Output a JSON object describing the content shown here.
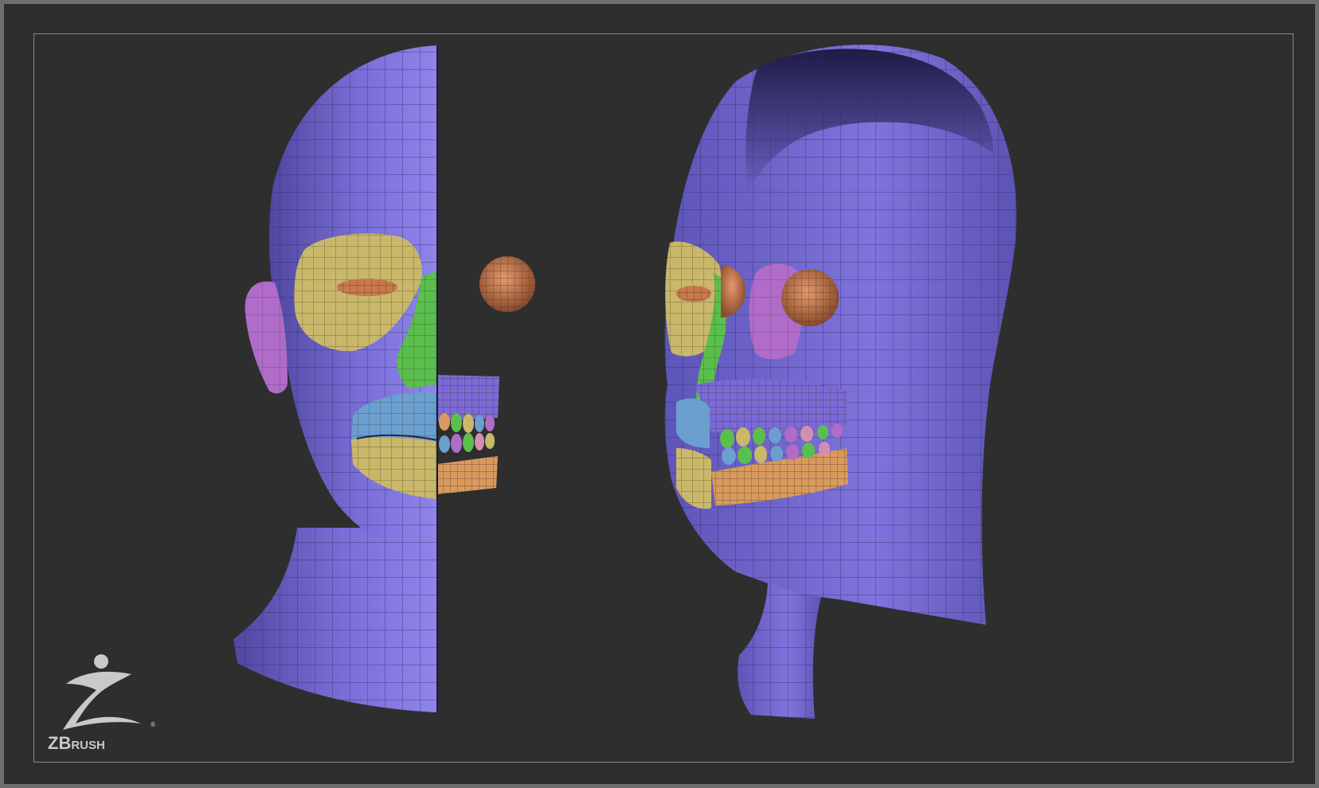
{
  "brand": {
    "logo_text": "ZBrush",
    "registered_mark": "®",
    "logo_icon": "zbrush-z-figure-icon"
  },
  "viewport": {
    "models": [
      {
        "name": "head-front-half",
        "view": "front"
      },
      {
        "name": "head-three-quarter-split",
        "view": "three-quarter"
      }
    ],
    "polygroup_colors": {
      "skin": "#6d62c9",
      "skin_light": "#8679e0",
      "eye_socket": "#c9b86a",
      "cheek": "#5bbf4d",
      "lip": "#6a9fd0",
      "ear": "#b06cc8",
      "teeth_gum": "#d99a5e",
      "eyeball": "#c9784e"
    }
  },
  "colors": {
    "frame": "#6e6e6e",
    "canvas": "#2e2e2e",
    "viewport_border": "#8a8a8a",
    "logo": "#c9c9c9"
  }
}
